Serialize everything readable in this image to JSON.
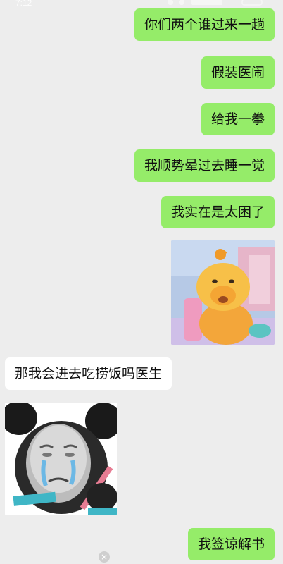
{
  "status": {
    "time": "7:12"
  },
  "messages": [
    {
      "side": "sent",
      "text": "你们两个谁过来一趟"
    },
    {
      "side": "sent",
      "text": "假装医闹"
    },
    {
      "side": "sent",
      "text": "给我一拳"
    },
    {
      "side": "sent",
      "text": "我顺势晕过去睡一觉"
    },
    {
      "side": "sent",
      "text": "我实在是太困了"
    },
    {
      "side": "sent",
      "sticker": "tired-yellow-cartoon-sticker-icon"
    },
    {
      "side": "recv",
      "text": "那我会进去吃捞饭吗医生"
    },
    {
      "side": "recv",
      "sticker": "crying-panda-meme-sticker-icon"
    },
    {
      "side": "sent",
      "text": "我签谅解书"
    }
  ],
  "icons": {
    "close": "×"
  },
  "colors": {
    "background": "#ededed",
    "sent_bubble": "#95ec69",
    "recv_bubble": "#ffffff"
  }
}
